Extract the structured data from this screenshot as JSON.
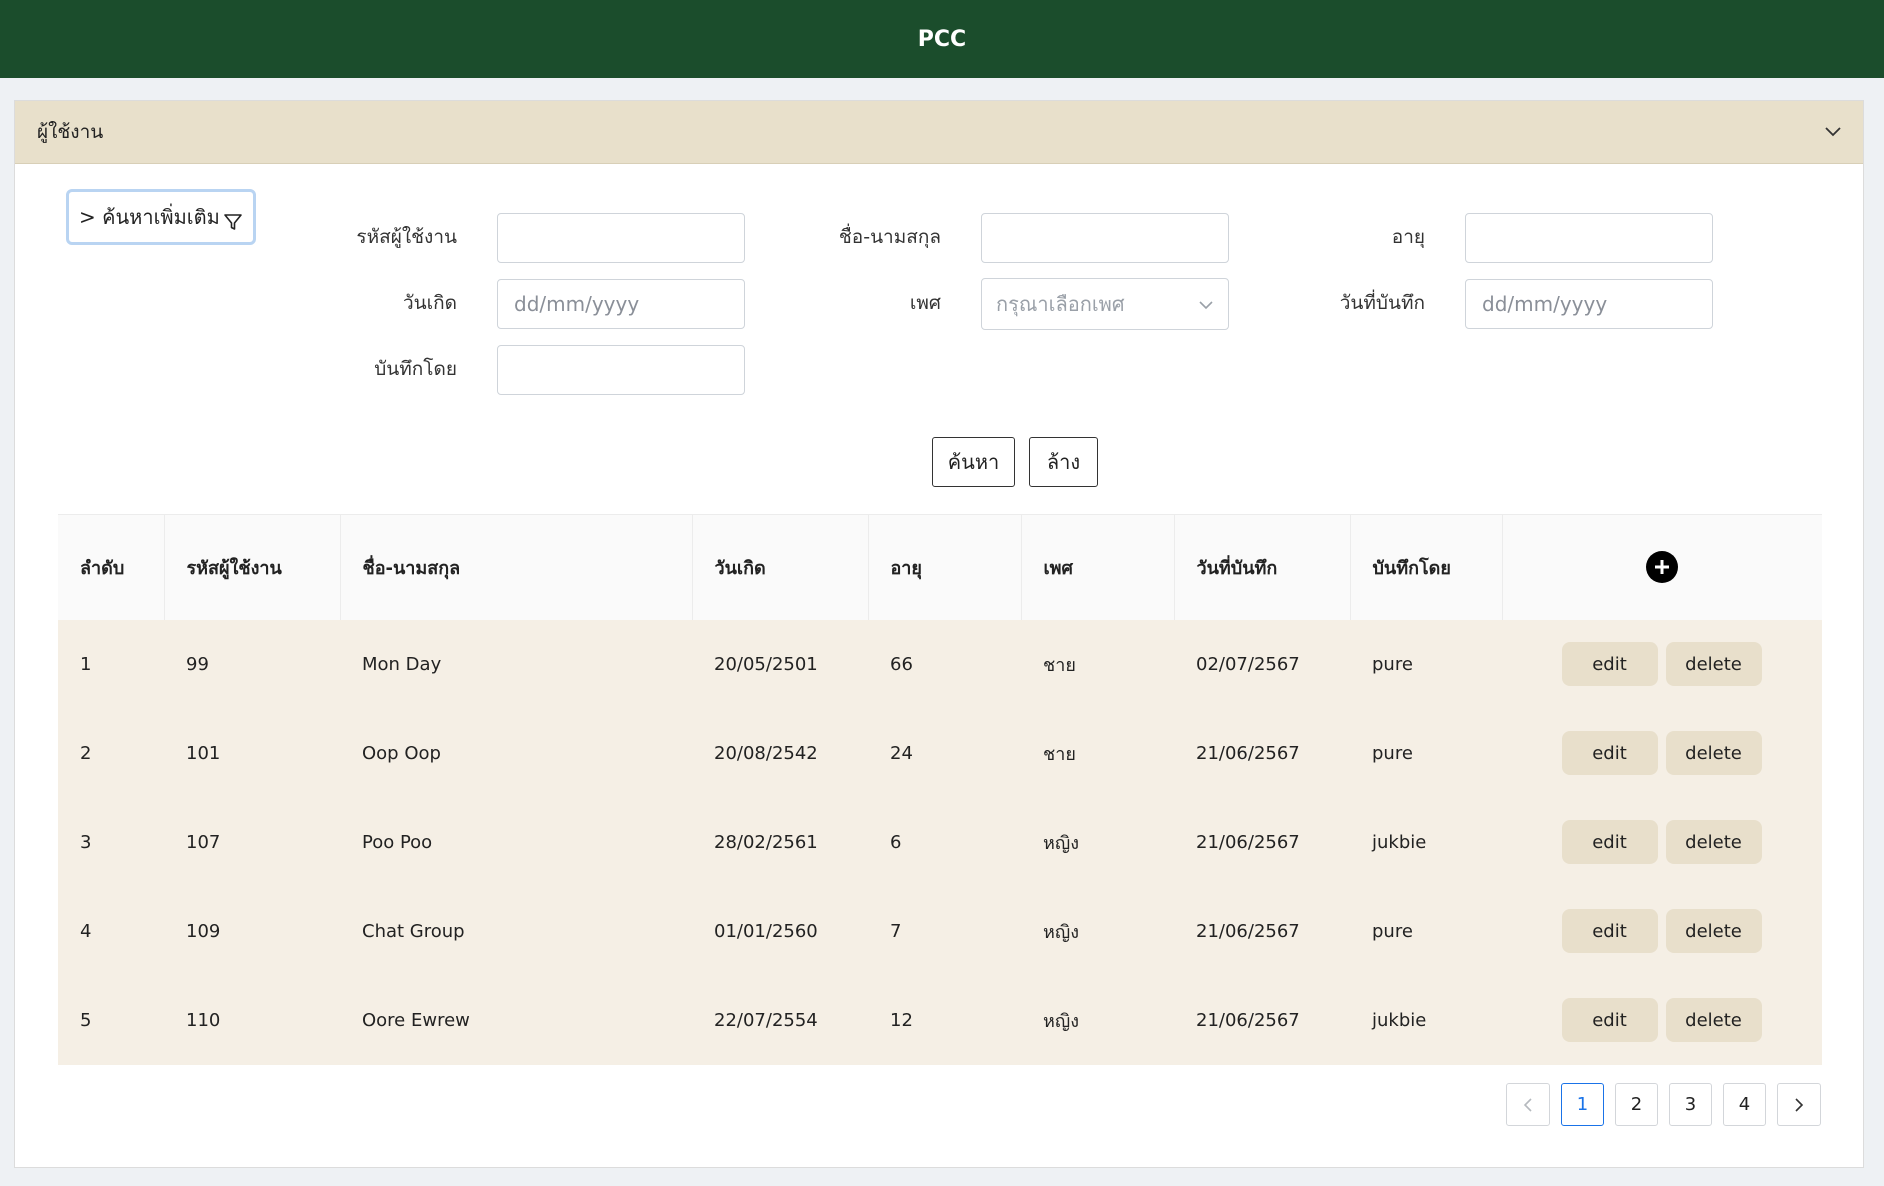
{
  "app": {
    "title": "PCC"
  },
  "panel": {
    "title": "ผู้ใช้งาน"
  },
  "filter": {
    "toggle_label": "> ค้นหาเพิ่มเติม",
    "fields": {
      "user_id": {
        "label": "รหัสผู้ใช้งาน",
        "value": "",
        "placeholder": ""
      },
      "full_name": {
        "label": "ชื่อ-นามสกุล",
        "value": "",
        "placeholder": ""
      },
      "age": {
        "label": "อายุ",
        "value": "",
        "placeholder": ""
      },
      "birth_date": {
        "label": "วันเกิด",
        "value": "",
        "placeholder": "dd/mm/yyyy"
      },
      "gender": {
        "label": "เพศ",
        "placeholder": "กรุณาเลือกเพศ"
      },
      "record_date": {
        "label": "วันที่บันทึก",
        "value": "",
        "placeholder": "dd/mm/yyyy"
      },
      "recorded_by": {
        "label": "บันทึกโดย",
        "value": "",
        "placeholder": ""
      }
    },
    "search_label": "ค้นหา",
    "clear_label": "ล้าง"
  },
  "table": {
    "columns": [
      "ลำดับ",
      "รหัสผู้ใช้งาน",
      "ชื่อ-นามสกุล",
      "วันเกิด",
      "อายุ",
      "เพศ",
      "วันที่บันทึก",
      "บันทึกโดย"
    ],
    "rows": [
      {
        "no": "1",
        "user_id": "99",
        "name": "Mon Day",
        "birth": "20/05/2501",
        "age": "66",
        "gender": "ชาย",
        "recorded": "02/07/2567",
        "by": "pure",
        "edit": "edit",
        "delete": "delete"
      },
      {
        "no": "2",
        "user_id": "101",
        "name": "Oop Oop",
        "birth": "20/08/2542",
        "age": "24",
        "gender": "ชาย",
        "recorded": "21/06/2567",
        "by": "pure",
        "edit": "edit",
        "delete": "delete"
      },
      {
        "no": "3",
        "user_id": "107",
        "name": "Poo Poo",
        "birth": "28/02/2561",
        "age": "6",
        "gender": "หญิง",
        "recorded": "21/06/2567",
        "by": "jukbie",
        "edit": "edit",
        "delete": "delete"
      },
      {
        "no": "4",
        "user_id": "109",
        "name": "Chat Group",
        "birth": "01/01/2560",
        "age": "7",
        "gender": "หญิง",
        "recorded": "21/06/2567",
        "by": "pure",
        "edit": "edit",
        "delete": "delete"
      },
      {
        "no": "5",
        "user_id": "110",
        "name": "Oore Ewrew",
        "birth": "22/07/2554",
        "age": "12",
        "gender": "หญิง",
        "recorded": "21/06/2567",
        "by": "jukbie",
        "edit": "edit",
        "delete": "delete"
      }
    ]
  },
  "pagination": {
    "pages": [
      "1",
      "2",
      "3",
      "4"
    ],
    "current": "1"
  },
  "colors": {
    "topbar": "#1b4d2c",
    "panel_header": "#e8e0cb",
    "row_bg": "#f5efe5",
    "action_btn": "#e8dfcb",
    "active_page": "#1a73e8"
  }
}
